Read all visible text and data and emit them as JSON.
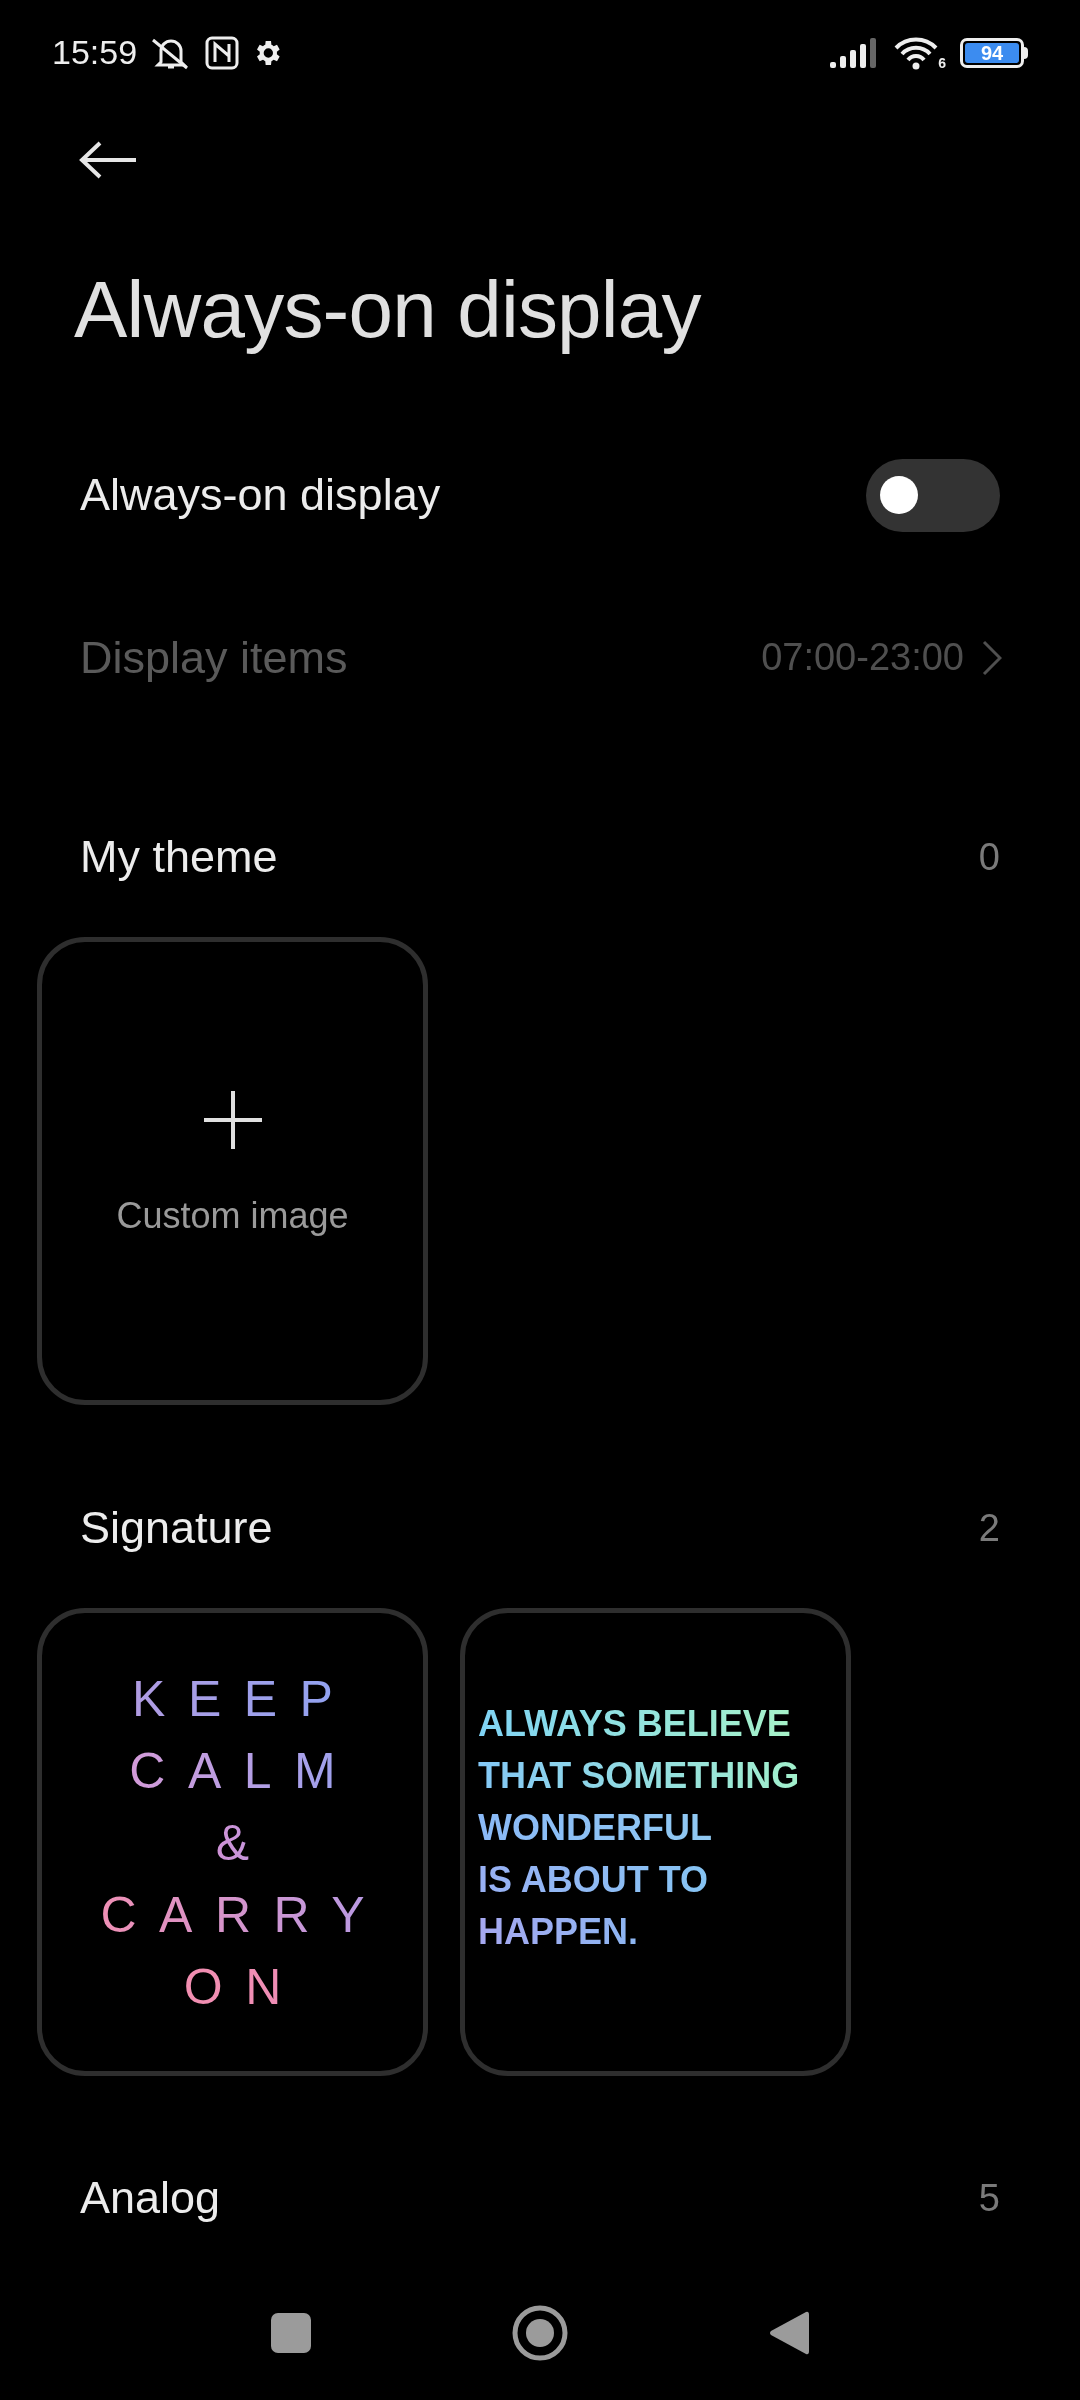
{
  "status_bar": {
    "time": "15:59",
    "wifi_badge": "6",
    "battery": "94"
  },
  "title": "Always-on display",
  "settings": [
    {
      "kind": "toggle",
      "label": "Always-on display",
      "on": false
    },
    {
      "kind": "link",
      "label": "Display items",
      "value": "07:00-23:00",
      "disabled": true
    }
  ],
  "sections": [
    {
      "title": "My theme",
      "count": "0",
      "cards": [
        {
          "kind": "add",
          "label": "Custom image"
        }
      ]
    },
    {
      "title": "Signature",
      "count": "2",
      "cards": [
        {
          "kind": "centered",
          "lines": [
            "KEEP",
            "CALM",
            "&",
            "CARRY",
            "ON"
          ]
        },
        {
          "kind": "quote",
          "lines": [
            "ALWAYS BELIEVE",
            "THAT SOMETHING",
            "WONDERFUL",
            "IS ABOUT TO",
            "HAPPEN."
          ]
        }
      ]
    },
    {
      "title": "Analog",
      "count": "5"
    }
  ]
}
